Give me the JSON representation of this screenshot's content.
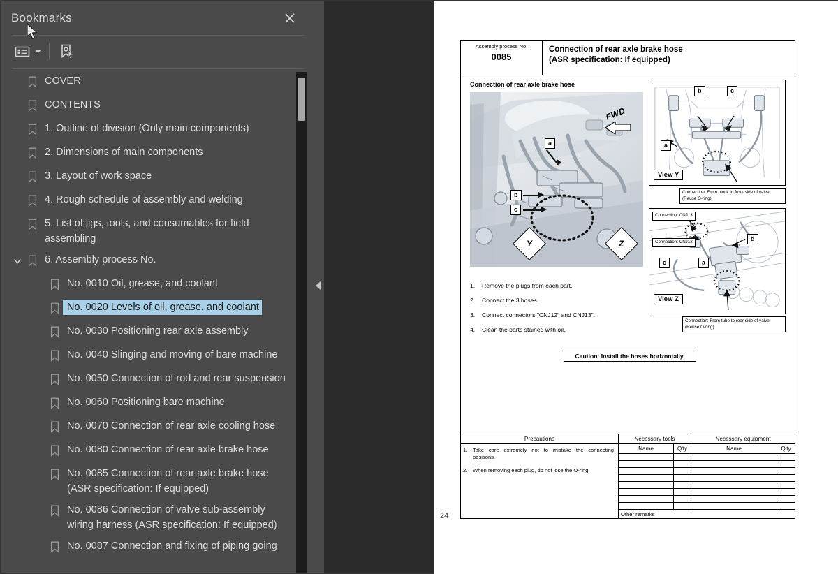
{
  "sidebar": {
    "title": "Bookmarks",
    "close_icon": "close-icon",
    "toolbar": {
      "options_label": "options-list-icon",
      "options_caret": "chevron-down-icon",
      "new_bookmark_label": "new-bookmark-icon"
    },
    "bookmarks": [
      {
        "label": "COVER",
        "level": 0,
        "expandable": false,
        "selected": false
      },
      {
        "label": "CONTENTS",
        "level": 0,
        "expandable": false,
        "selected": false
      },
      {
        "label": "1. Outline of division (Only main components)",
        "level": 0,
        "expandable": false,
        "selected": false
      },
      {
        "label": "2. Dimensions of main components",
        "level": 0,
        "expandable": false,
        "selected": false
      },
      {
        "label": "3. Layout of work space",
        "level": 0,
        "expandable": false,
        "selected": false
      },
      {
        "label": "4. Rough schedule of assembly and welding",
        "level": 0,
        "expandable": false,
        "selected": false
      },
      {
        "label": "5. List of jigs, tools, and consumables for field assembling",
        "level": 0,
        "expandable": false,
        "selected": false
      },
      {
        "label": "6. Assembly process No.",
        "level": 0,
        "expandable": true,
        "expanded": true,
        "selected": false
      },
      {
        "label": "No. 0010 Oil, grease, and coolant",
        "level": 1,
        "expandable": false,
        "selected": false
      },
      {
        "label": "No. 0020 Levels of oil, grease, and coolant",
        "level": 1,
        "expandable": false,
        "selected": true
      },
      {
        "label": "No. 0030 Positioning rear axle assembly",
        "level": 1,
        "expandable": false,
        "selected": false
      },
      {
        "label": "No. 0040 Slinging and moving of bare machine",
        "level": 1,
        "expandable": false,
        "selected": false
      },
      {
        "label": "No. 0050 Connection of rod and rear suspension",
        "level": 1,
        "expandable": false,
        "selected": false
      },
      {
        "label": "No. 0060 Positioning bare machine",
        "level": 1,
        "expandable": false,
        "selected": false
      },
      {
        "label": "No. 0070 Connection of rear axle cooling hose",
        "level": 1,
        "expandable": false,
        "selected": false
      },
      {
        "label": "No. 0080 Connection of rear axle brake hose",
        "level": 1,
        "expandable": false,
        "selected": false
      },
      {
        "label": "No. 0085 Connection of rear axle brake hose (ASR specification: If equipped)",
        "level": 1,
        "expandable": false,
        "selected": false
      },
      {
        "label": "No. 0086 Connection of valve sub-assembly wiring harness (ASR specification: If equipped)",
        "level": 1,
        "expandable": false,
        "selected": false
      },
      {
        "label": "No. 0087 Connection and fixing of piping going",
        "level": 1,
        "expandable": false,
        "selected": false
      }
    ]
  },
  "splitter": {
    "collapse_icon": "triangle-left-icon"
  },
  "document": {
    "page_number": "24",
    "header": {
      "left_label": "Assembly process No.",
      "process_no": "0085",
      "title_line1": "Connection of rear axle brake hose",
      "title_line2": "(ASR specification: If equipped)"
    },
    "figure_caption": "Connection of rear axle brake hose",
    "main_photo": {
      "fwd_label": "FWD",
      "callouts": [
        "a",
        "b",
        "c"
      ],
      "view_marks": [
        "Y",
        "Z"
      ]
    },
    "view_y": {
      "label": "View Y",
      "callouts": [
        "a",
        "b",
        "c"
      ],
      "note_line1": "Connection: From block to front side of valve",
      "note_line2": "(Reuse O-ring)"
    },
    "view_z": {
      "label": "View Z",
      "callouts": [
        "a",
        "c",
        "d"
      ],
      "connector_top": "Connection: CNJ13",
      "connector_bottom": "Connection: CNJ12",
      "note_line1": "Connection: From tube to rear side of valve",
      "note_line2": "(Reuse O-ring)"
    },
    "steps": [
      {
        "n": "1.",
        "text": "Remove the plugs from each part."
      },
      {
        "n": "2.",
        "text": "Connect the 3 hoses."
      },
      {
        "n": "3.",
        "text": "Connect connectors \"CNJ12\" and CNJ13\"."
      },
      {
        "n": "4.",
        "text": "Clean the parts stained with oil."
      }
    ],
    "caution": "Caution: Install the hoses horizontally.",
    "bottom_table": {
      "precautions_header": "Precautions",
      "tools_header": "Necessary tools",
      "equipment_header": "Necessary equipment",
      "sub_headers": {
        "name": "Name",
        "qty": "Q'ty",
        "name2": "Name",
        "qty2": "Q'ty"
      },
      "precautions": [
        {
          "n": "1.",
          "text": "Take care extremely not to mistake the connecting positions."
        },
        {
          "n": "2.",
          "text": "When removing each plug, do not lose the O-ring."
        }
      ],
      "other_remarks": "Other remarks",
      "empty_rows": 8
    }
  },
  "colors": {
    "sidebar_bg": "#4a4a4a",
    "viewer_bg": "#2b2b2b",
    "selection": "#a8d0e6",
    "page": "#ffffff",
    "text": "#dcdcdc"
  }
}
